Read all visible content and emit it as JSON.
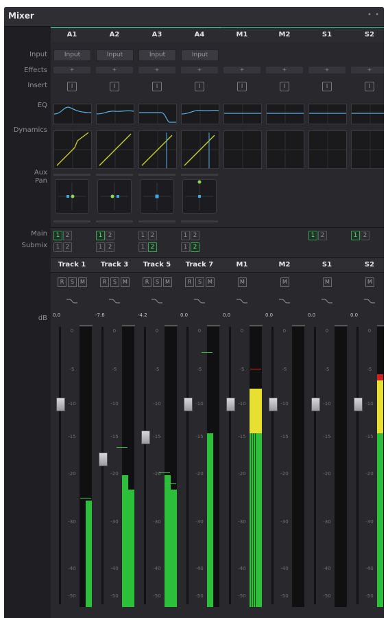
{
  "window": {
    "title": "Mixer",
    "options_icon": "more-dots-icon"
  },
  "row_labels": {
    "input": "Input",
    "effects": "Effects",
    "insert": "Insert",
    "eq": "EQ",
    "dynamics": "Dynamics",
    "aux": "Aux",
    "pan": "Pan",
    "main": "Main",
    "submix": "Submix",
    "db": "dB"
  },
  "colors": {
    "accent_teal": "#4a9a8a",
    "curve": "#5ab0e0",
    "dyn_line": "#c8d632",
    "pan_blue": "#3aa8e8",
    "pan_green": "#8ed65a",
    "meter_green": "#2cc03a",
    "meter_yellow": "#e8e030",
    "meter_red": "#d02020"
  },
  "channels": [
    {
      "id": "A1",
      "input": "Input",
      "effects": "+",
      "insert": "I",
      "track": "Track 1",
      "db": "0.0",
      "main": [
        {
          "label": "1",
          "on": true
        },
        {
          "label": "2",
          "on": false
        }
      ],
      "submix": [
        {
          "label": "1",
          "on": false
        },
        {
          "label": "2",
          "on": false
        }
      ],
      "buttons": [
        "R",
        "S",
        "M"
      ],
      "fader_db": -10,
      "has_pan": true,
      "meters": [
        {
          "level": 0.0,
          "peak": null
        },
        {
          "level": 0.38,
          "peak": 0.39
        }
      ]
    },
    {
      "id": "A2",
      "input": "Input",
      "effects": "+",
      "insert": "I",
      "track": "Track 3",
      "db": "-7.6",
      "main": [
        {
          "label": "1",
          "on": true
        },
        {
          "label": "2",
          "on": false
        }
      ],
      "submix": [
        {
          "label": "1",
          "on": false
        },
        {
          "label": "2",
          "on": false
        }
      ],
      "buttons": [
        "R",
        "S",
        "M"
      ],
      "fader_db": -18,
      "has_pan": true,
      "meters": [
        {
          "level": 0.47,
          "peak": 0.57
        },
        {
          "level": 0.42,
          "peak": null
        }
      ]
    },
    {
      "id": "A3",
      "input": "Input",
      "effects": "+",
      "insert": "I",
      "track": "Track 5",
      "db": "-4.2",
      "main": [
        {
          "label": "1",
          "on": false
        },
        {
          "label": "2",
          "on": false
        }
      ],
      "submix": [
        {
          "label": "1",
          "on": false
        },
        {
          "label": "2",
          "on": true
        }
      ],
      "buttons": [
        "R",
        "S",
        "M"
      ],
      "fader_db": -15,
      "has_pan": true,
      "meters": [
        {
          "level": 0.47,
          "peak": 0.48
        },
        {
          "level": 0.42,
          "peak": 0.44
        }
      ]
    },
    {
      "id": "A4",
      "input": "Input",
      "effects": "+",
      "insert": "I",
      "track": "Track 7",
      "db": "0.0",
      "main": [
        {
          "label": "1",
          "on": false
        },
        {
          "label": "2",
          "on": false
        }
      ],
      "submix": [
        {
          "label": "1",
          "on": false
        },
        {
          "label": "2",
          "on": true
        }
      ],
      "buttons": [
        "R",
        "S",
        "M"
      ],
      "fader_db": -10,
      "has_pan": true,
      "meters": [
        {
          "level": 0.62,
          "peak": 0.91,
          "yellow": 0.82
        },
        {
          "level": 0.0,
          "peak": null
        }
      ]
    },
    {
      "id": "M1",
      "input": "",
      "effects": "+",
      "insert": "I",
      "track": "M1",
      "db": "0.0",
      "main": [],
      "submix": [],
      "buttons": [
        "M"
      ],
      "fader_db": -10,
      "has_pan": false,
      "meters": [
        {
          "level": 0.78,
          "peak": null,
          "yellow": 0.62,
          "striped": true
        },
        {
          "level": 0.78,
          "peak": 0.85,
          "yellow": 0.62,
          "redpeak": true
        }
      ]
    },
    {
      "id": "M2",
      "input": "",
      "effects": "+",
      "insert": "I",
      "track": "M2",
      "db": "0.0",
      "main": [],
      "submix": [],
      "buttons": [
        "M"
      ],
      "fader_db": -10,
      "has_pan": false,
      "meters": [
        {
          "level": 0.0,
          "peak": null
        },
        {
          "level": 0.0,
          "peak": null
        }
      ]
    },
    {
      "id": "S1",
      "input": "",
      "effects": "+",
      "insert": "I",
      "track": "S1",
      "db": "0.0",
      "main": [
        {
          "label": "1",
          "on": true
        },
        {
          "label": "2",
          "on": false
        }
      ],
      "submix": [],
      "buttons": [
        "M"
      ],
      "fader_db": -10,
      "has_pan": false,
      "meters": [
        {
          "level": 0.0,
          "peak": null
        },
        {
          "level": 0.0,
          "peak": null
        }
      ]
    },
    {
      "id": "S2",
      "input": "",
      "effects": "+",
      "insert": "I",
      "track": "S2",
      "db": "0.0",
      "main": [
        {
          "label": "1",
          "on": true
        },
        {
          "label": "2",
          "on": false
        }
      ],
      "submix": [],
      "buttons": [
        "M"
      ],
      "fader_db": -10,
      "has_pan": false,
      "meters": [
        {
          "level": 0.83,
          "peak": null,
          "yellow": 0.62,
          "red": 0.81
        },
        {
          "level": 0.0,
          "peak": null
        }
      ]
    }
  ],
  "scale_ticks": [
    "0",
    "-5",
    "-10",
    "-15",
    "-20",
    "-30",
    "-40",
    "-50"
  ]
}
